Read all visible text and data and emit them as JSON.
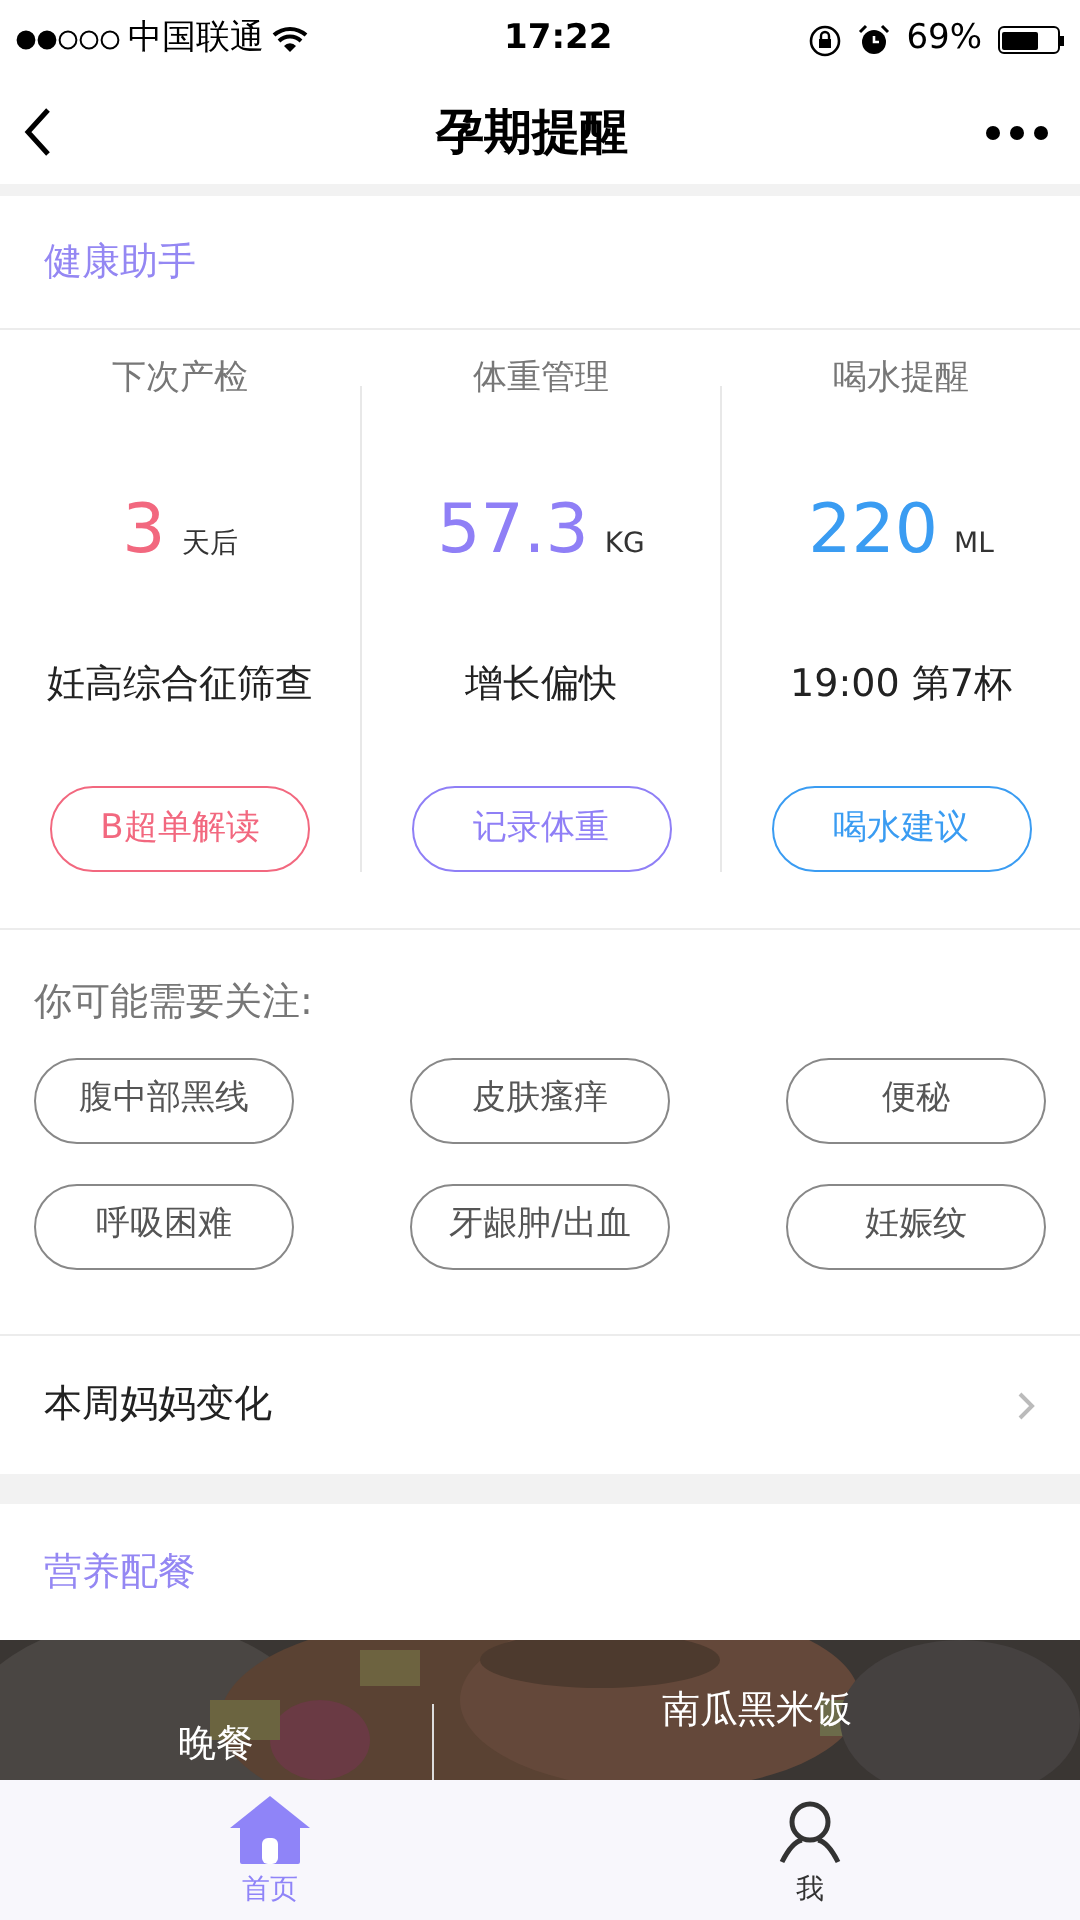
{
  "status_bar": {
    "carrier": "中国联通",
    "time": "17:22",
    "battery": "69%"
  },
  "nav": {
    "title": "孕期提醒"
  },
  "health": {
    "title": "健康助手",
    "cards": [
      {
        "label": "下次产检",
        "value": "3",
        "unit": "天后",
        "detail": "妊高综合征筛查",
        "button": "B超单解读",
        "color": "#f2687f"
      },
      {
        "label": "体重管理",
        "value": "57.3",
        "unit": "KG",
        "detail": "增长偏快",
        "button": "记录体重",
        "color": "#8f7ff6"
      },
      {
        "label": "喝水提醒",
        "value": "220",
        "unit": "ML",
        "detail": "19:00 第7杯",
        "button": "喝水建议",
        "color": "#3a9cf2"
      }
    ]
  },
  "attention": {
    "title": "你可能需要关注:",
    "tags": [
      "腹中部黑线",
      "皮肤瘙痒",
      "便秘",
      "呼吸困难",
      "牙龈肿/出血",
      "妊娠纹"
    ]
  },
  "weekly": {
    "label": "本周妈妈变化"
  },
  "nutrition": {
    "title": "营养配餐",
    "meal": "晚餐",
    "dish": "南瓜黑米饭"
  },
  "tabs": [
    {
      "label": "首页",
      "kind": "home",
      "selected": true
    },
    {
      "label": "我",
      "kind": "me",
      "selected": false
    }
  ]
}
